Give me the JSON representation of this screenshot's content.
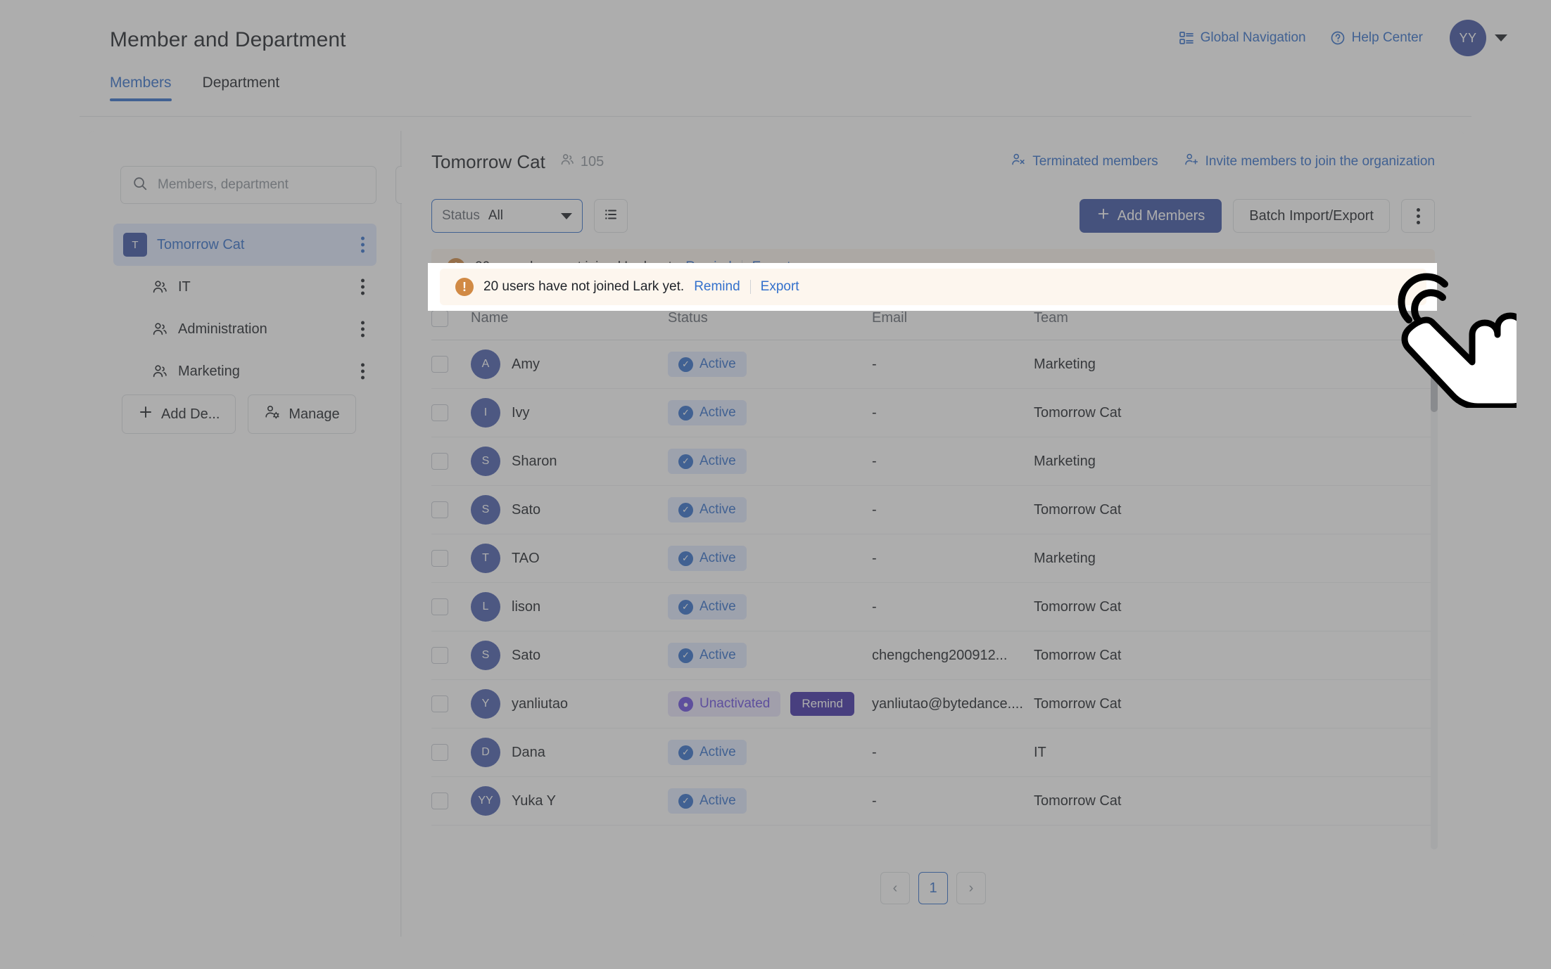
{
  "header": {
    "title": "Member and Department",
    "links": [
      {
        "label": "Global Navigation",
        "icon": "grid-list-icon"
      },
      {
        "label": "Help Center",
        "icon": "question-circle-icon"
      }
    ],
    "avatar_initials": "YY"
  },
  "tabs": [
    {
      "label": "Members",
      "active": true
    },
    {
      "label": "Department",
      "active": false
    }
  ],
  "sidebar": {
    "search_placeholder": "Members, department",
    "search_value": "",
    "collapse_icon": "menu-fold-icon",
    "tree": [
      {
        "label": "Tomorrow Cat",
        "badge": "T",
        "type": "root",
        "selected": true
      },
      {
        "label": "IT",
        "type": "child",
        "icon": "team-icon"
      },
      {
        "label": "Administration",
        "type": "child",
        "icon": "team-icon"
      },
      {
        "label": "Marketing",
        "type": "child",
        "icon": "team-icon"
      }
    ],
    "actions": [
      {
        "label": "Add De...",
        "icon": "plus-icon"
      },
      {
        "label": "Manage",
        "icon": "member-settings-icon"
      }
    ]
  },
  "main": {
    "org_name": "Tomorrow Cat",
    "member_count": "105",
    "head_links": [
      {
        "label": "Terminated members",
        "icon": "member-remove-icon"
      },
      {
        "label": "Invite members to join the organization",
        "icon": "member-add-icon"
      }
    ],
    "toolbar": {
      "status_label": "Status",
      "status_value": "All",
      "list_view_icon": "list-view-icon",
      "add_members_label": "Add Members",
      "batch_label": "Batch Import/Export",
      "more_icon": "more-vertical-icon"
    },
    "alert": {
      "icon": "warning-icon",
      "text": "20 users have not joined Lark yet.",
      "remind_label": "Remind",
      "export_label": "Export"
    },
    "table": {
      "columns": [
        "Name",
        "Status",
        "Email",
        "Team"
      ],
      "rows": [
        {
          "initial": "A",
          "name": "Amy",
          "status": "Active",
          "remind": null,
          "email": "-",
          "team": "Marketing"
        },
        {
          "initial": "I",
          "name": "Ivy",
          "status": "Active",
          "remind": null,
          "email": "-",
          "team": "Tomorrow Cat"
        },
        {
          "initial": "S",
          "name": "Sharon",
          "status": "Active",
          "remind": null,
          "email": "-",
          "team": "Marketing"
        },
        {
          "initial": "S",
          "name": "Sato",
          "status": "Active",
          "remind": null,
          "email": "-",
          "team": "Tomorrow Cat"
        },
        {
          "initial": "T",
          "name": "TAO",
          "status": "Active",
          "remind": null,
          "email": "-",
          "team": "Marketing"
        },
        {
          "initial": "L",
          "name": "lison",
          "status": "Active",
          "remind": null,
          "email": "-",
          "team": "Tomorrow Cat"
        },
        {
          "initial": "S",
          "name": "Sato",
          "status": "Active",
          "remind": null,
          "email": "chengcheng200912...",
          "team": "Tomorrow Cat"
        },
        {
          "initial": "Y",
          "name": "yanliutao",
          "status": "Unactivated",
          "remind": "Remind",
          "email": "yanliutao@bytedance....",
          "team": "Tomorrow Cat"
        },
        {
          "initial": "D",
          "name": "Dana",
          "status": "Active",
          "remind": null,
          "email": "-",
          "team": "IT"
        },
        {
          "initial": "YY",
          "name": "Yuka Y",
          "status": "Active",
          "remind": null,
          "email": "-",
          "team": "Tomorrow Cat"
        }
      ]
    },
    "pagination": {
      "prev": "‹",
      "current": "1",
      "next": "›"
    }
  },
  "cursor": {
    "icon": "pointing-hand-cursor"
  },
  "colors": {
    "accent": "#3370cc",
    "primary_button": "#3c53a4",
    "alert_bg": "#fdf6ee",
    "alert_icon": "#d18a45",
    "unactivated": "#6a4ee0",
    "remind_chip": "#4030a8"
  }
}
